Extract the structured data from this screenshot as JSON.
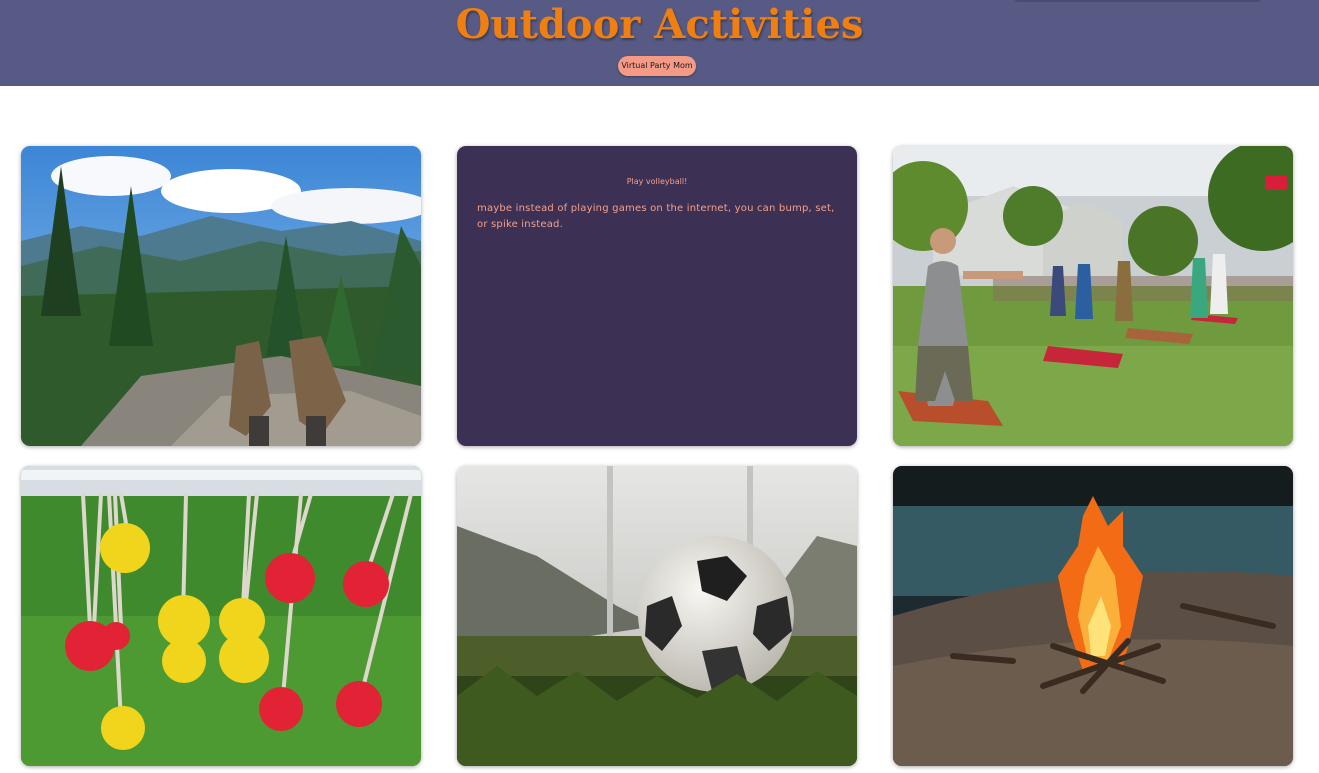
{
  "header": {
    "title": "Outdoor Activities",
    "badge_label": "Virtual Party Mom",
    "background_color": "#575a84",
    "title_color": "#f07f12",
    "badge_color": "#f49a86"
  },
  "cards": [
    {
      "kind": "image",
      "image": "hiking-boots-mountain-view-photo"
    },
    {
      "kind": "text",
      "title": "Play volleyball!",
      "body": "maybe instead of playing games on the internet, you can bump, set, or spike instead.",
      "background_color": "#3c3054",
      "text_color": "#f3a08b"
    },
    {
      "kind": "image",
      "image": "cornhole-game-in-park-photo"
    },
    {
      "kind": "image",
      "image": "ladder-ball-bolas-on-grass-photo"
    },
    {
      "kind": "image",
      "image": "soccer-ball-on-grass-photo"
    },
    {
      "kind": "image",
      "image": "campfire-by-lake-photo"
    }
  ]
}
